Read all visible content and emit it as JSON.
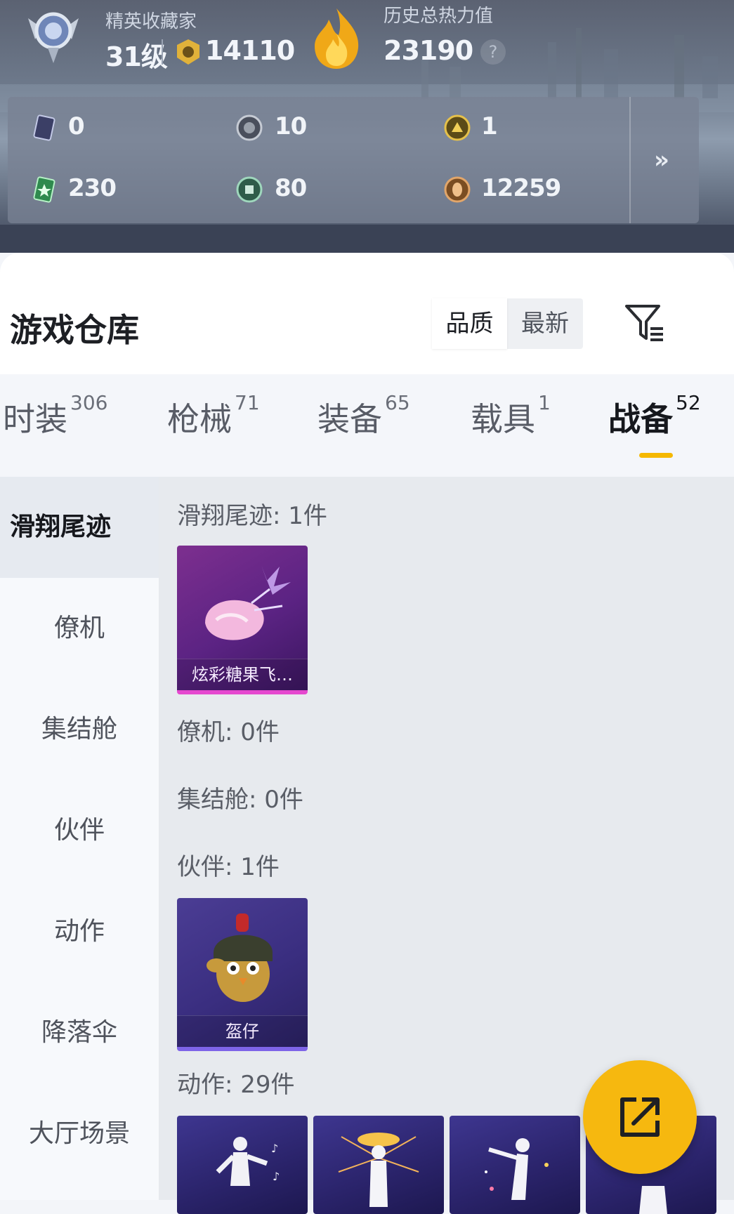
{
  "profile": {
    "title": "精英收藏家",
    "level": "31级",
    "points": "14110",
    "heat_label": "历史总热力值",
    "heat_value": "23190",
    "help_icon": "?"
  },
  "stats": {
    "items": [
      {
        "icon": "card-icon",
        "value": "0"
      },
      {
        "icon": "token-gray-icon",
        "value": "10"
      },
      {
        "icon": "token-gold-icon",
        "value": "1"
      },
      {
        "icon": "green-card-icon",
        "value": "230"
      },
      {
        "icon": "green-coin-icon",
        "value": "80"
      },
      {
        "icon": "bronze-coin-icon",
        "value": "12259"
      }
    ],
    "expand_label": "»"
  },
  "warehouse": {
    "title": "游戏仓库",
    "sort_quality": "品质",
    "sort_newest": "最新"
  },
  "tabs": [
    {
      "label": "时装",
      "count": "306"
    },
    {
      "label": "枪械",
      "count": "71"
    },
    {
      "label": "装备",
      "count": "65"
    },
    {
      "label": "载具",
      "count": "1"
    },
    {
      "label": "战备",
      "count": "52"
    }
  ],
  "sidebar": [
    {
      "label": "滑翔尾迹"
    },
    {
      "label": "僚机"
    },
    {
      "label": "集结舱"
    },
    {
      "label": "伙伴"
    },
    {
      "label": "动作"
    },
    {
      "label": "降落伞"
    },
    {
      "label": "大厅场景"
    }
  ],
  "sections": [
    {
      "title": "滑翔尾迹: 1件"
    },
    {
      "title": "僚机: 0件"
    },
    {
      "title": "集结舱: 0件"
    },
    {
      "title": "伙伴: 1件"
    },
    {
      "title": "动作: 29件"
    }
  ],
  "cards": {
    "trail": {
      "label": "炫彩糖果飞…"
    },
    "partner": {
      "label": "盔仔"
    }
  },
  "colors": {
    "accent": "#f5b800",
    "purple_card": "#5b2383",
    "blue_card": "#3a2e80"
  }
}
